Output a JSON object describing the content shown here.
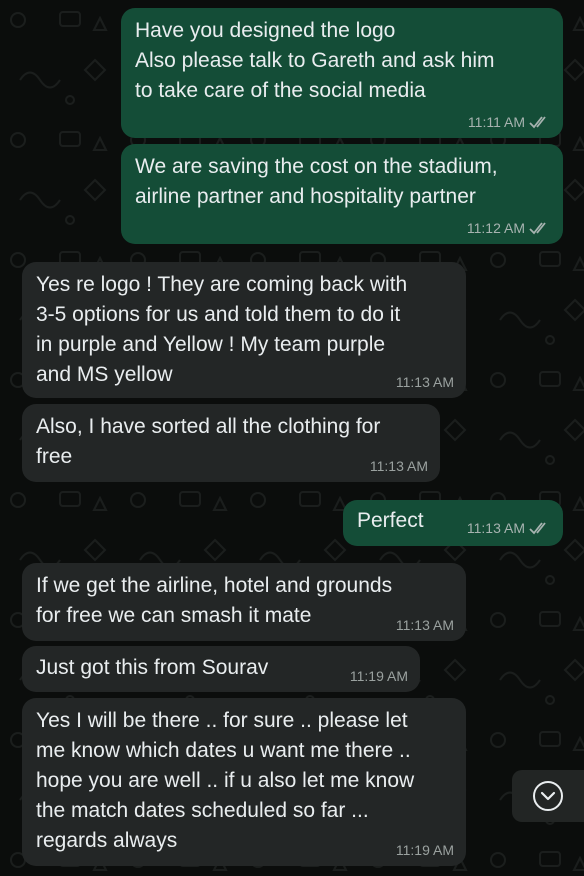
{
  "messages": [
    {
      "dir": "out",
      "text": "Have you designed the logo\nAlso please talk to Gareth and ask him\nto take care of the social media",
      "time": "11:11 AM",
      "read": true
    },
    {
      "dir": "out",
      "text": "We are saving the cost on the stadium,\nairline partner and hospitality partner",
      "time": "11:12 AM",
      "read": true
    },
    {
      "dir": "in",
      "text": "Yes re logo ! They are coming back with\n3-5 options for us and told them to do it\nin purple and Yellow ! My team purple\nand MS yellow",
      "time": "11:13 AM"
    },
    {
      "dir": "in",
      "text": "Also, I have sorted all the clothing for\nfree",
      "time": "11:13 AM"
    },
    {
      "dir": "out",
      "text": "Perfect",
      "time": "11:13 AM",
      "read": true
    },
    {
      "dir": "in",
      "text": "If we get the airline, hotel and grounds\nfor free we can smash it mate",
      "time": "11:13 AM"
    },
    {
      "dir": "in",
      "text": "Just got this from Sourav",
      "time": "11:19 AM"
    },
    {
      "dir": "in",
      "text": "Yes I will be there .. for sure .. please let\nme know which dates u want me there ..\nhope you are well .. if u also let me know\nthe match dates scheduled so far ...\nregards always",
      "time": "11:19 AM"
    }
  ],
  "scroll_button": {
    "icon": "chevron-down-icon"
  },
  "colors": {
    "outgoing": "#144d37",
    "incoming": "#232626",
    "read_ticks": "#a7b3b0",
    "background": "#0b0d0c"
  }
}
